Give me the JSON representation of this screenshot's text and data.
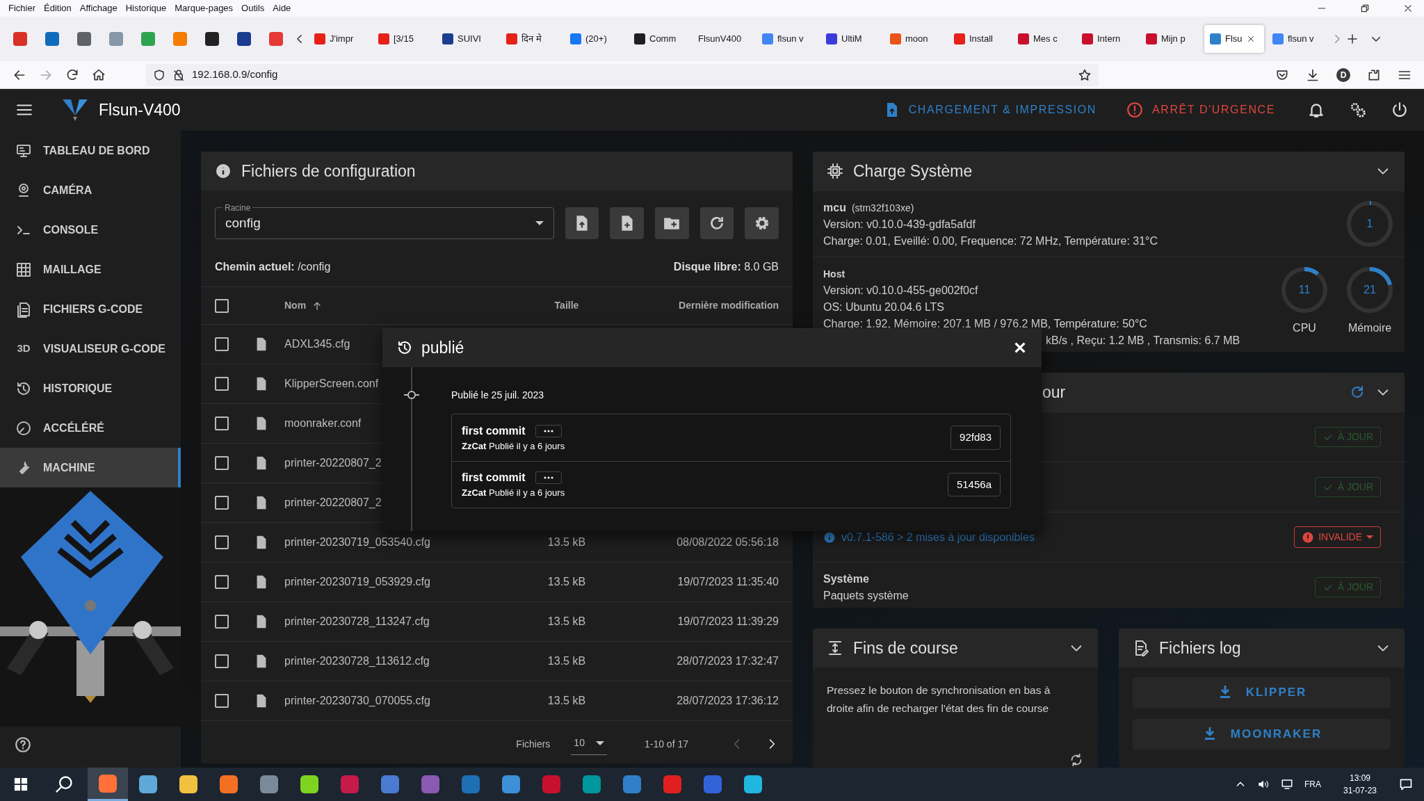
{
  "menu_bar": [
    "Fichier",
    "Édition",
    "Affichage",
    "Historique",
    "Marque-pages",
    "Outils",
    "Aide"
  ],
  "browser_tabs": [
    {
      "title": "J'impr",
      "selected": false
    },
    {
      "title": "[3/15",
      "selected": false
    },
    {
      "title": "SUIVI",
      "selected": false
    },
    {
      "title": "दिन मे",
      "selected": false
    },
    {
      "title": "(20+)",
      "selected": false
    },
    {
      "title": "Comm",
      "selected": false
    },
    {
      "title": "FlsunV400",
      "selected": false
    },
    {
      "title": "flsun v",
      "selected": false
    },
    {
      "title": "UltiM",
      "selected": false
    },
    {
      "title": "moon",
      "selected": false
    },
    {
      "title": "Install",
      "selected": false
    },
    {
      "title": "Mes c",
      "selected": false
    },
    {
      "title": "Intern",
      "selected": false
    },
    {
      "title": "Mijn p",
      "selected": false
    },
    {
      "title": "Flsu",
      "selected": true
    },
    {
      "title": "flsun v",
      "selected": false
    }
  ],
  "address_bar": {
    "url": "192.168.0.9/config",
    "account_initial": "D"
  },
  "app": {
    "title": "Flsun-V400",
    "upload_button": "CHARGEMENT & IMPRESSION",
    "emergency_button": "ARRÊT D'URGENCE"
  },
  "sidebar": {
    "items": [
      {
        "label": "TABLEAU DE BORD",
        "selected": false
      },
      {
        "label": "CAMÉRA",
        "selected": false
      },
      {
        "label": "CONSOLE",
        "selected": false
      },
      {
        "label": "MAILLAGE",
        "selected": false
      },
      {
        "label": "FICHIERS G-CODE",
        "selected": false
      },
      {
        "label": "VISUALISEUR G-CODE",
        "icon_text": "3D",
        "selected": false
      },
      {
        "label": "HISTORIQUE",
        "selected": false
      },
      {
        "label": "ACCÉLÉRÉ",
        "selected": false
      },
      {
        "label": "MACHINE",
        "selected": true
      }
    ]
  },
  "config_files": {
    "title": "Fichiers de configuration",
    "root_field": {
      "label": "Racine",
      "value": "config"
    },
    "path_label": "Chemin actuel:",
    "path": "/config",
    "disk_label": "Disque libre:",
    "disk": "8.0 GB",
    "select_all": {
      "checked": false
    },
    "columns": [
      "Nom",
      "Taille",
      "Dernière modification"
    ],
    "rows": [
      {
        "name": "ADXL345.cfg",
        "checked": false
      },
      {
        "name": "KlipperScreen.conf",
        "checked": false
      },
      {
        "name": "moonraker.conf",
        "checked": false
      },
      {
        "name": "printer-20220807_2",
        "checked": false
      },
      {
        "name": "printer-20220807_2",
        "checked": false
      },
      {
        "name": "printer-20230719_053540.cfg",
        "size": "13.5 kB",
        "modified": "08/08/2022 05:56:18",
        "checked": false
      },
      {
        "name": "printer-20230719_053929.cfg",
        "size": "13.5 kB",
        "modified": "19/07/2023 11:35:40",
        "checked": false
      },
      {
        "name": "printer-20230728_113247.cfg",
        "size": "13.5 kB",
        "modified": "19/07/2023 11:39:29",
        "checked": false
      },
      {
        "name": "printer-20230728_113612.cfg",
        "size": "13.5 kB",
        "modified": "28/07/2023 17:32:47",
        "checked": false
      },
      {
        "name": "printer-20230730_070055.cfg",
        "size": "13.5 kB",
        "modified": "28/07/2023 17:36:12",
        "checked": false
      }
    ],
    "footer": {
      "label": "Fichiers",
      "per_page": "10",
      "range": "1-10 of 17"
    }
  },
  "modal": {
    "title": "publié",
    "date": "Publié le 25 juil. 2023",
    "commits": [
      {
        "message": "first commit",
        "author": "ZzCat",
        "when": "Publié il y a 6 jours",
        "hash": "92fd83"
      },
      {
        "message": "first commit",
        "author": "ZzCat",
        "when": "Publié il y a 6 jours",
        "hash": "51456a"
      }
    ]
  },
  "system_load": {
    "title": "Charge Système",
    "mcu": {
      "name": "mcu",
      "chip": "(stm32f103xe)",
      "lines": [
        "Version: v0.10.0-439-gdfa5afdf",
        "Charge: 0.01, Eveillé: 0.00, Frequence: 72 MHz, Température: 31°C"
      ],
      "gauges": [
        {
          "value": "1",
          "level": 0.01
        }
      ]
    },
    "host": {
      "name": "Host",
      "lines": [
        "Version: v0.10.0-455-ge002f0cf",
        "OS: Ubuntu 20.04.6 LTS",
        "Charge: 1.92, Mémoire: 207.1 MB / 976.2 MB, Température: 50°C"
      ],
      "partial_line": "kB/s , Reçu: 1.2 MB , Transmis: 6.7 MB",
      "gauges": [
        {
          "value": "11",
          "label": "CPU",
          "level": 0.11
        },
        {
          "value": "21",
          "label": "Mémoire",
          "level": 0.21
        }
      ]
    }
  },
  "updates": {
    "title_visible": "our",
    "items": [
      {
        "kind": "ok",
        "status": "À JOUR"
      },
      {
        "kind": "ok",
        "status": "À JOUR"
      },
      {
        "kind": "invalid",
        "link": "v0.7.1-586 > 2 mises à jour disponibles",
        "status": "INVALIDE"
      },
      {
        "kind": "ok",
        "name": "Système",
        "description": "Paquets système",
        "status": "À JOUR"
      }
    ]
  },
  "endstops": {
    "title": "Fins de course",
    "text": "Pressez le bouton de synchronisation en bas à droite afin de recharger l'état des fin de course"
  },
  "logs": {
    "title": "Fichiers log",
    "buttons": [
      "KLIPPER",
      "MOONRAKER"
    ]
  },
  "taskbar": {
    "apps": [
      {
        "selected": true
      },
      {
        "selected": false
      },
      {
        "selected": false
      },
      {
        "selected": false
      },
      {
        "selected": false
      },
      {
        "selected": false
      },
      {
        "selected": false
      },
      {
        "selected": false
      },
      {
        "selected": false
      },
      {
        "selected": false
      },
      {
        "selected": false
      },
      {
        "selected": false
      },
      {
        "selected": false
      },
      {
        "selected": false
      },
      {
        "selected": false
      },
      {
        "selected": false
      },
      {
        "selected": false
      }
    ],
    "language": "FRA",
    "time": "13:09",
    "date": "31-07-23"
  }
}
